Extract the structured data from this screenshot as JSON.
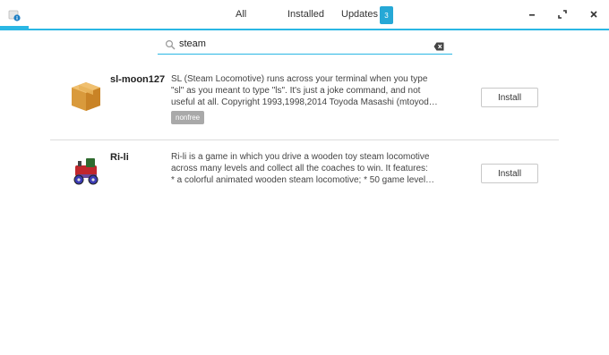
{
  "header": {
    "tabs": [
      {
        "label": "All"
      },
      {
        "label": "Installed"
      },
      {
        "label": "Updates"
      }
    ],
    "updates_count": "3"
  },
  "search": {
    "value": "steam"
  },
  "results": [
    {
      "name": "sl-moon127",
      "description_lines": [
        "SL (Steam Locomotive) runs across your terminal when you type",
        "\"sl\" as you meant to type \"ls\". It's just a joke command, and not",
        "useful at all. Copyright 1993,1998,2014 Toyoda Masashi (mtoyoda…"
      ],
      "tag": "nonfree",
      "install_label": "Install",
      "icon": "package-box-icon"
    },
    {
      "name": "Ri-li",
      "description_lines": [
        "Ri-li is a game in which you drive a wooden toy steam locomotive",
        "across many levels and collect all the coaches to win.  It features:",
        "* a colorful animated wooden steam locomotive; * 50 game level…"
      ],
      "install_label": "Install",
      "icon": "toy-train-icon"
    }
  ],
  "colors": {
    "accent": "#2ab7e4",
    "badge": "#26a8d6",
    "tag_bg": "#a9a9a9"
  }
}
